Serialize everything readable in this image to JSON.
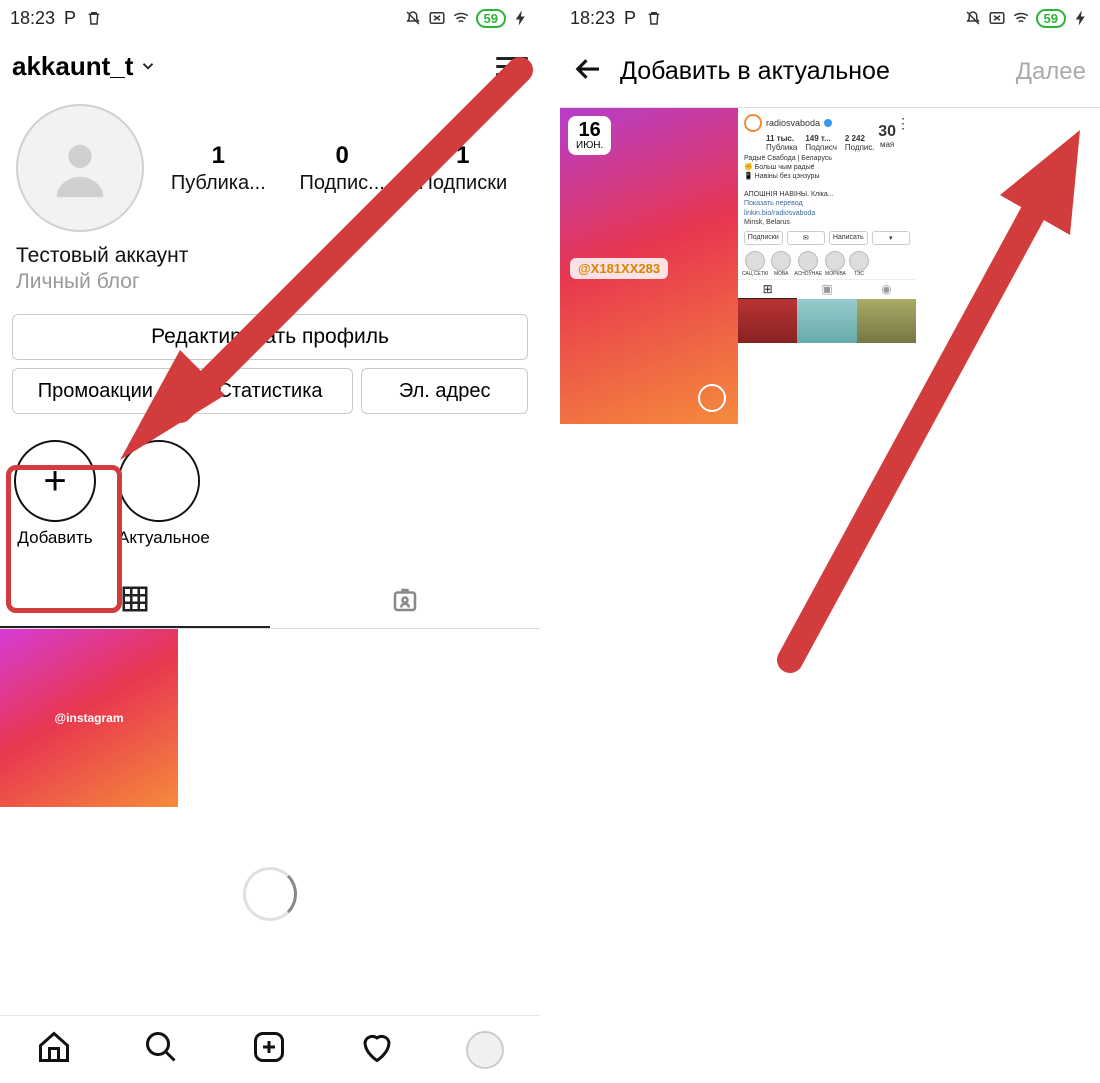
{
  "status": {
    "time": "18:23",
    "battery_pct": "59"
  },
  "left": {
    "username": "akkaunt_t",
    "stats": [
      {
        "value": "1",
        "label": "Публика..."
      },
      {
        "value": "0",
        "label": "Подпис..."
      },
      {
        "value": "1",
        "label": "Подписки"
      }
    ],
    "bio_name": "Тестовый аккаунт",
    "bio_category": "Личный блог",
    "edit_profile_btn": "Редактировать профиль",
    "buttons": {
      "promo": "Промоакции",
      "stats": "Статистика",
      "email": "Эл. адрес"
    },
    "highlights": {
      "add": "Добавить",
      "current": "Актуальное"
    },
    "post_tag": "@instagram"
  },
  "right": {
    "title": "Добавить в актуальное",
    "next": "Далее",
    "story1": {
      "day": "16",
      "month": "июн.",
      "tag": "@X181XX283"
    },
    "story2": {
      "day": "30",
      "month": "мая",
      "prof_name": "radiosvaboda",
      "stats": [
        {
          "v": "11 тыс.",
          "l": "Публика"
        },
        {
          "v": "149 т...",
          "l": "Подписч"
        },
        {
          "v": "2 242",
          "l": "Подписки"
        }
      ],
      "bio_lines": [
        "Радыё Свабода | Беларусь",
        "✊ Больш чым радыё",
        "📱 Навіны без цэнзуры",
        "",
        "АПОШНІЯ НАВІНЫ. Кліка...",
        "Показать перевод"
      ],
      "link": "linkin.bio/radiosvaboda",
      "loc": "Minsk, Belarus",
      "btns": [
        "Подписки",
        "✉",
        "Написать",
        "▾"
      ],
      "highlights": [
        "САЦ.СЕТКІ",
        "МОВА",
        "АСНОЎНАЕ",
        "МОРКВА",
        "ТЭС"
      ]
    }
  }
}
